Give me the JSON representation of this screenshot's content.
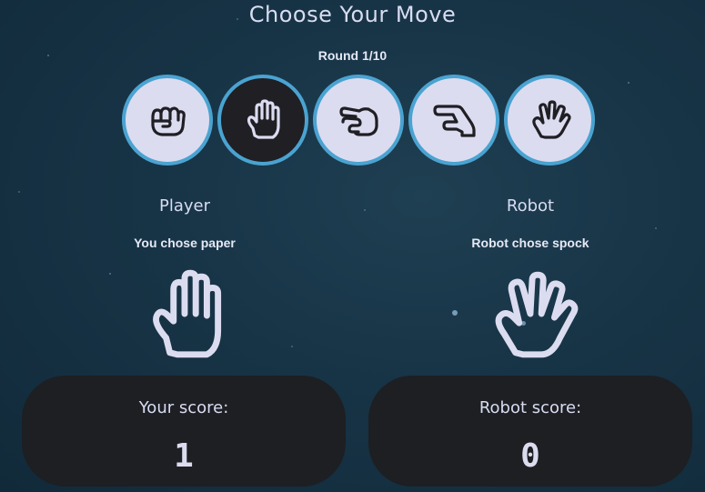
{
  "header": {
    "title": "Choose Your Move",
    "round": "Round 1/10"
  },
  "moves": [
    {
      "name": "rock",
      "icon": "hand-fist-icon",
      "selected": false
    },
    {
      "name": "paper",
      "icon": "hand-paper-icon",
      "selected": true
    },
    {
      "name": "scissors",
      "icon": "hand-scissors-icon",
      "selected": false
    },
    {
      "name": "lizard",
      "icon": "hand-lizard-icon",
      "selected": false
    },
    {
      "name": "spock",
      "icon": "hand-spock-icon",
      "selected": false
    }
  ],
  "player": {
    "title": "Player",
    "choice_text": "You chose paper",
    "hand_icon": "hand-paper-icon",
    "score_label": "Your score:",
    "score": "1"
  },
  "robot": {
    "title": "Robot",
    "choice_text": "Robot chose spock",
    "hand_icon": "hand-spock-icon",
    "score_label": "Robot score:",
    "score": "0"
  },
  "colors": {
    "background": "#173446",
    "move_fill": "#dcdcf0",
    "move_selected_fill": "#1f1f24",
    "move_border": "#4aa3d1",
    "card": "#1d1f23",
    "text": "#dcdcf0"
  }
}
